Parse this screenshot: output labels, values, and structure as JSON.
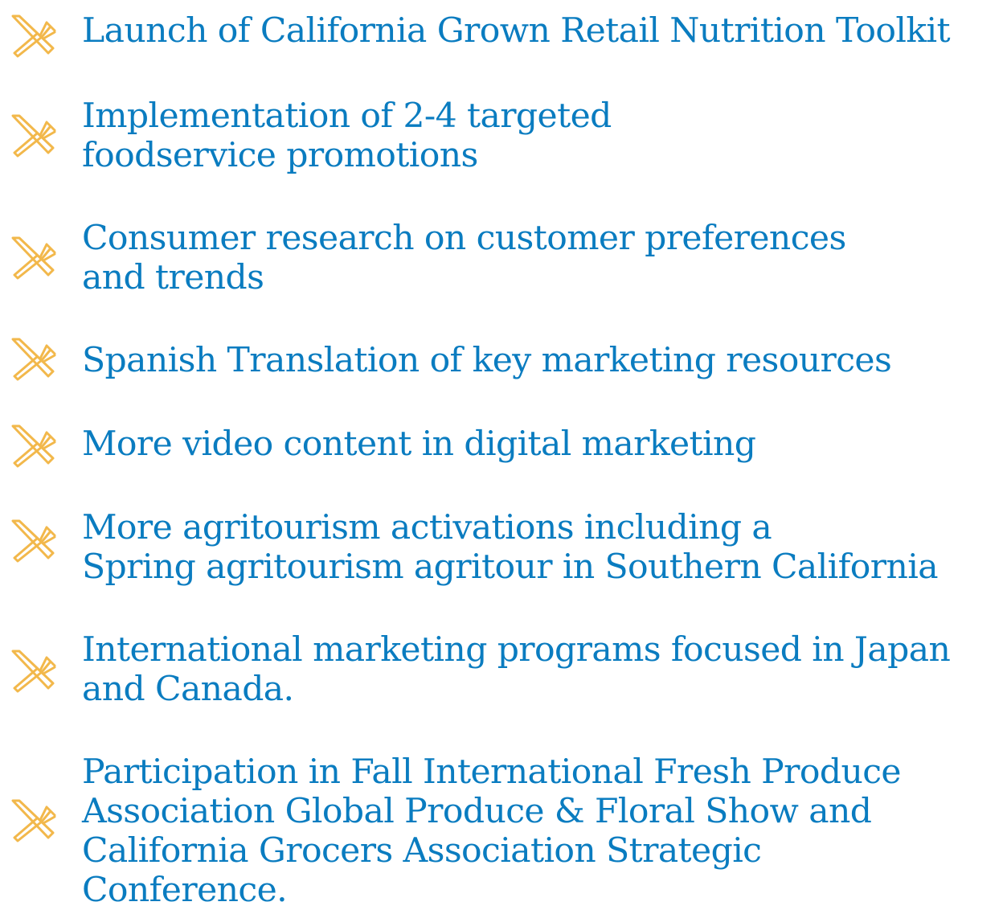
{
  "items": [
    {
      "icon": "fork-and-knife-icon",
      "text": "Launch of California Grown Retail Nutrition Toolkit"
    },
    {
      "icon": "fork-and-knife-icon",
      "text": "Implementation of 2-4 targeted\nfoodservice promotions"
    },
    {
      "icon": "fork-and-knife-icon",
      "text": "Consumer research on customer preferences\nand trends"
    },
    {
      "icon": "fork-and-knife-icon",
      "text": "Spanish Translation of key marketing resources"
    },
    {
      "icon": "fork-and-knife-icon",
      "text": "More video content in digital marketing"
    },
    {
      "icon": "fork-and-knife-icon",
      "text": "More agritourism activations including a\nSpring agritourism agritour in Southern California"
    },
    {
      "icon": "fork-and-knife-icon",
      "text": "International marketing programs focused in Japan\nand Canada."
    },
    {
      "icon": "fork-and-knife-icon",
      "text": "Participation in Fall International Fresh Produce\nAssociation Global Produce & Floral Show and\nCalifornia Grocers Association Strategic\nConference."
    }
  ],
  "colors": {
    "text": "#0a7cc0",
    "icon": "#f2b84b"
  }
}
